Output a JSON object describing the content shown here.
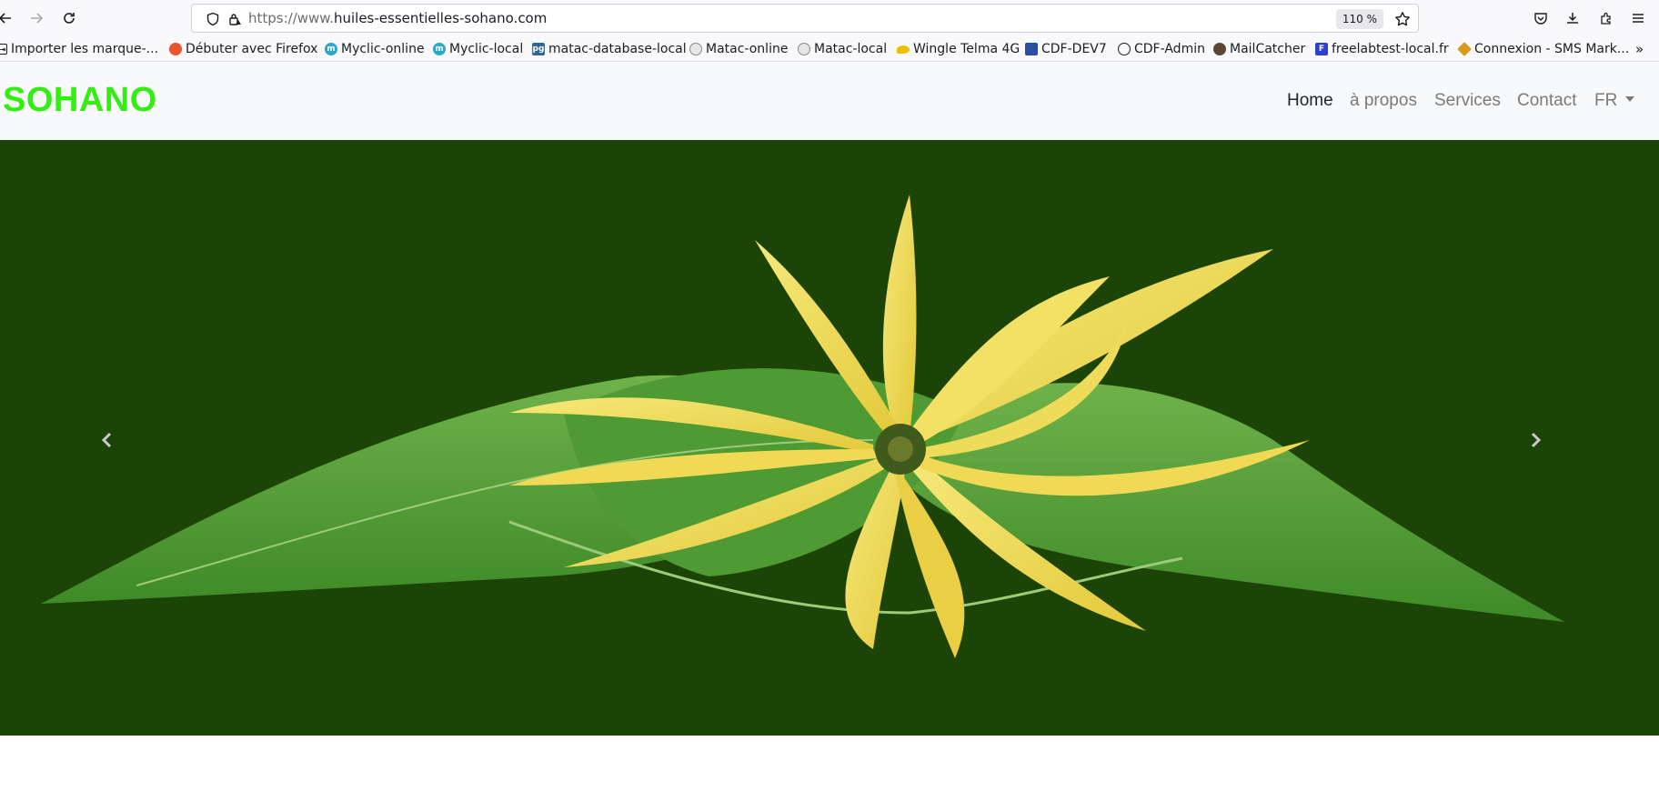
{
  "browser": {
    "url_prefix": "https://www.",
    "url_domain": "huiles-essentielles-sohano.com",
    "zoom": "110 %",
    "bookmarks": [
      {
        "label": "Importer les marque-...",
        "icon": "import-icon",
        "color": "#1c1b22"
      },
      {
        "label": "Débuter avec Firefox",
        "icon": "firefox-icon",
        "color": "#e8552b"
      },
      {
        "label": "Myclic-online",
        "icon": "myclic-icon",
        "color": "#2aa7c9"
      },
      {
        "label": "Myclic-local",
        "icon": "myclic-icon",
        "color": "#2aa7c9"
      },
      {
        "label": "matac-database-local",
        "icon": "pg-icon",
        "color": "#336791"
      },
      {
        "label": "Matac-online",
        "icon": "globe-circle-icon",
        "color": "#8a8a8a"
      },
      {
        "label": "Matac-local",
        "icon": "globe-circle-icon",
        "color": "#8a8a8a"
      },
      {
        "label": "Wingle Telma 4G",
        "icon": "wingle-icon",
        "color": "#e8c200"
      },
      {
        "label": "CDF-DEV7",
        "icon": "cdf-icon",
        "color": "#2b4fa0"
      },
      {
        "label": "CDF-Admin",
        "icon": "globe-icon",
        "color": "#1c1b22"
      },
      {
        "label": "MailCatcher",
        "icon": "mailcatcher-icon",
        "color": "#5a4634"
      },
      {
        "label": "freelabtest-local.fr",
        "icon": "f-icon",
        "color": "#2c3fd1"
      },
      {
        "label": "Connexion - SMS Mark...",
        "icon": "diamond-icon",
        "color": "#d99a1c"
      }
    ]
  },
  "site": {
    "brand": "SOHANO",
    "brand_color": "#33ee11",
    "nav": [
      {
        "label": "Home",
        "active": true
      },
      {
        "label": "à propos",
        "active": false
      },
      {
        "label": "Services",
        "active": false
      },
      {
        "label": "Contact",
        "active": false
      }
    ],
    "language": "FR",
    "carousel": {
      "background": "#1c4406",
      "image": "ylang-ylang-flower-on-leaves"
    }
  }
}
